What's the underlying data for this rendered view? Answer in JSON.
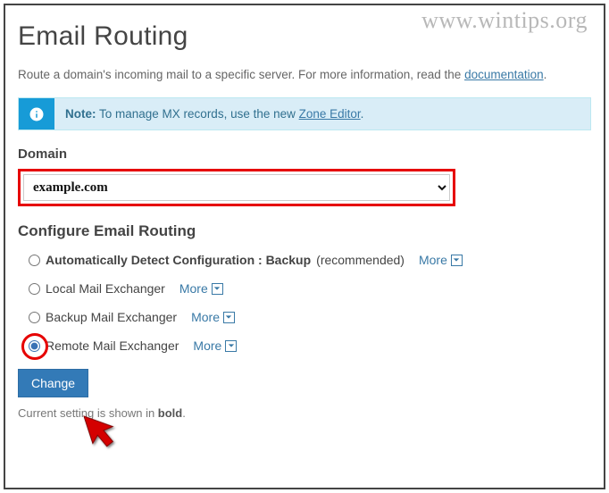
{
  "watermark": "www.wintips.org",
  "page_title": "Email Routing",
  "intro_prefix": "Route a domain's incoming mail to a specific server. For more information, read the ",
  "intro_link": "documentation",
  "intro_suffix": ".",
  "alert": {
    "note_label": "Note:",
    "text_prefix": " To manage MX records, use the new ",
    "link": "Zone Editor",
    "text_suffix": "."
  },
  "domain_label": "Domain",
  "domain_value": "example.com",
  "configure_label": "Configure Email Routing",
  "options": {
    "auto_label": "Automatically Detect Configuration : Backup",
    "auto_rec": " (recommended)",
    "local_label": "Local Mail Exchanger",
    "backup_label": "Backup Mail Exchanger",
    "remote_label": "Remote Mail Exchanger",
    "more_label": "More"
  },
  "change_button": "Change",
  "hint_prefix": "Current setting is shown in ",
  "hint_bold": "bold",
  "hint_suffix": "."
}
